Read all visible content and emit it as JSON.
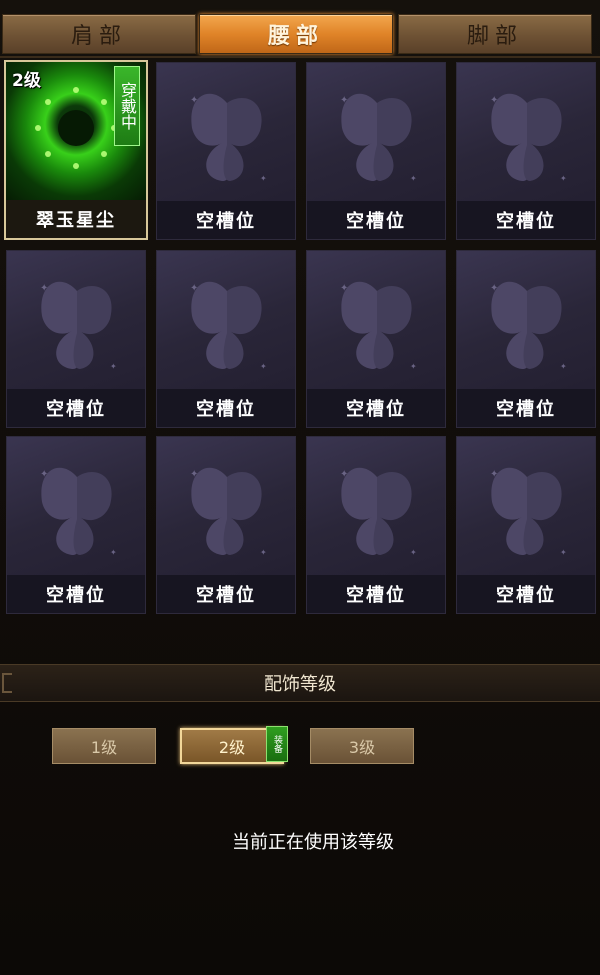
{
  "tabs": [
    {
      "label": "肩部",
      "active": false
    },
    {
      "label": "腰部",
      "active": true
    },
    {
      "label": "脚部",
      "active": false
    }
  ],
  "equipped_slot": {
    "level": "2级",
    "wearing": "穿戴中",
    "name": "翠玉星尘"
  },
  "empty_slots": [
    "空槽位",
    "空槽位",
    "空槽位",
    "空槽位",
    "空槽位",
    "空槽位",
    "空槽位",
    "空槽位",
    "空槽位",
    "空槽位",
    "空槽位"
  ],
  "section": {
    "title": "配饰等级"
  },
  "levels": [
    {
      "label": "1级",
      "selected": false
    },
    {
      "label": "2级",
      "selected": true
    },
    {
      "label": "3级",
      "selected": false
    }
  ],
  "equip_badge": "装备",
  "status_text": "当前正在使用该等级",
  "colors": {
    "active_tab": "#e08428",
    "inactive_tab": "#7a5c3a",
    "slot_bg": "#2a2639",
    "equipped_glow": "#38d01a",
    "equip_badge": "#2f9e1f"
  },
  "icons": {
    "empty_slot": "butterfly-icon",
    "equipped_art": "jade-stardust-icon"
  }
}
